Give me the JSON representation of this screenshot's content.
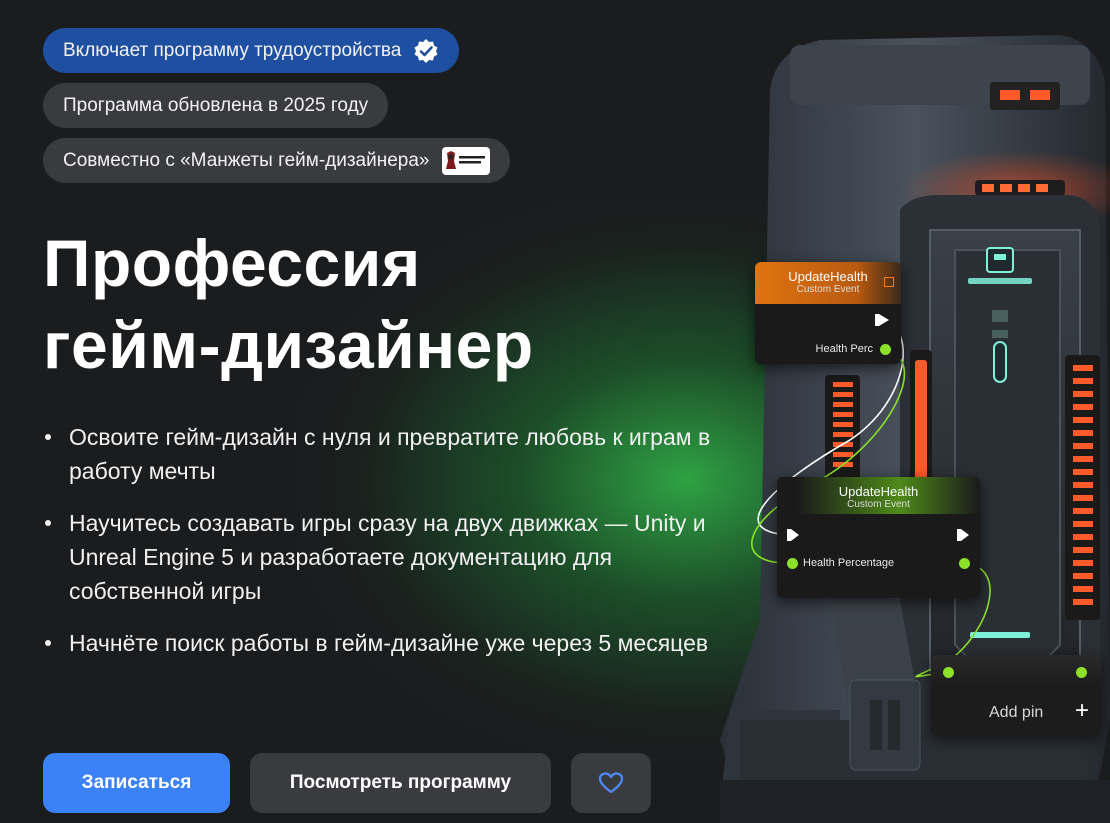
{
  "badges": [
    {
      "label": "Включает программу трудоустройства",
      "icon": "verified-check-icon",
      "color": "#1f4fa0"
    },
    {
      "label": "Программа обновлена в 2025 году"
    },
    {
      "label": "Совместно с «Манжеты гейм-дизайнера»",
      "icon": "manzhety-logo-icon"
    }
  ],
  "hero": {
    "title_line1": "Профессия",
    "title_line2": "гейм-дизайнер"
  },
  "bullets": [
    "Освоите гейм-дизайн с нуля и превратите любовь к играм в работу мечты",
    "Научитесь создавать игры сразу на двух движках — Unity и Unreal Engine 5 и разработаете документацию для собственной игры",
    "Начнёте поиск работы в гейм-дизайне уже через 5 месяцев"
  ],
  "buttons": {
    "enroll": "Записаться",
    "view_program": "Посмотреть программу",
    "favorite_icon": "heart-icon"
  },
  "illustration": {
    "node1": {
      "title": "UpdateHealth",
      "subtitle": "Custom Event",
      "pin": "Health Perc"
    },
    "node2": {
      "title": "UpdateHealth",
      "subtitle": "Custom Event",
      "pin": "Health Percentage"
    },
    "node3": {
      "label": "Add pin",
      "plus": "+"
    }
  },
  "colors": {
    "primary": "#3b82f6",
    "badge_blue": "#1f4fa0",
    "pin_green": "#8de12a",
    "node_orange": "#e0740f"
  }
}
